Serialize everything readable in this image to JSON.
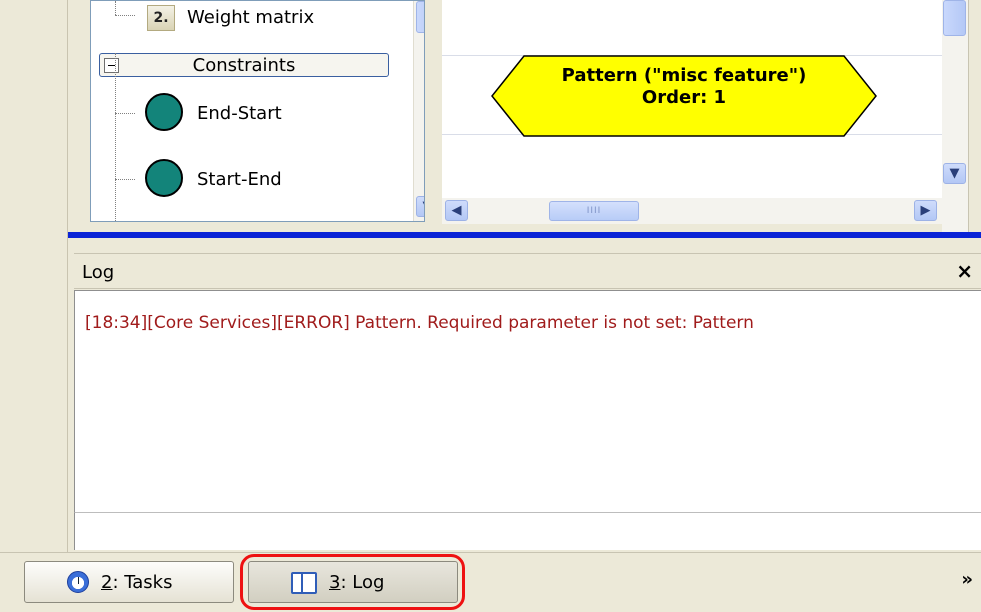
{
  "tree": {
    "weight_matrix_label": "Weight matrix",
    "weight_matrix_icon_text": "2.",
    "constraints_label": "Constraints",
    "items": [
      {
        "label": "End-Start"
      },
      {
        "label": "Start-End"
      }
    ]
  },
  "canvas": {
    "node_title": "Pattern (\"misc feature\")",
    "node_order": "Order: 1",
    "node_color": "#ffff00"
  },
  "log": {
    "title": "Log",
    "close_label": "×",
    "entries": [
      "[18:34][Core Services][ERROR] Pattern. Required parameter is not set: Pattern"
    ]
  },
  "tabs": {
    "tasks": {
      "mnemonic": "2",
      "label": ": Tasks",
      "icon": "clock-icon"
    },
    "log": {
      "mnemonic": "3",
      "label": ": Log",
      "icon": "book-icon"
    },
    "overflow_label": "»"
  },
  "colors": {
    "frame_blue": "#0b24d6",
    "constraint_circle": "#13847a",
    "error_text": "#a01b1b",
    "highlight_ring": "#e11111"
  }
}
